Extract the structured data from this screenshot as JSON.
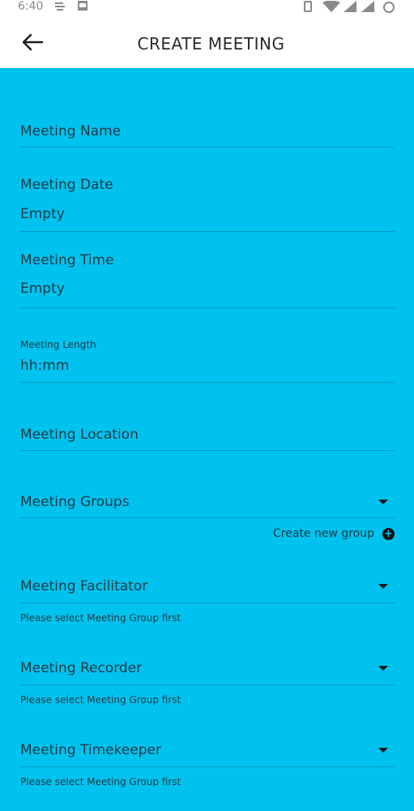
{
  "status_bar": {
    "time": "6:40"
  },
  "app_bar": {
    "title": "CREATE MEETING"
  },
  "form": {
    "meeting_name_label": "Meeting Name",
    "meeting_date_label": "Meeting Date",
    "meeting_date_value": "Empty",
    "meeting_time_label": "Meeting Time",
    "meeting_time_value": "Empty",
    "meeting_length_label": "Meeting Length",
    "meeting_length_value": "hh:mm",
    "meeting_location_label": "Meeting Location",
    "meeting_groups_label": "Meeting Groups",
    "create_new_group_label": "Create new group",
    "meeting_facilitator_label": "Meeting Facilitator",
    "meeting_facilitator_hint": "Please select Meeting Group first",
    "meeting_recorder_label": "Meeting Recorder",
    "meeting_recorder_hint": "Please select Meeting Group first",
    "meeting_timekeeper_label": "Meeting Timekeeper",
    "meeting_timekeeper_hint": "Please select Meeting Group first"
  },
  "colors": {
    "background": "#00C2EE",
    "app_bar": "#FFFFFF"
  }
}
